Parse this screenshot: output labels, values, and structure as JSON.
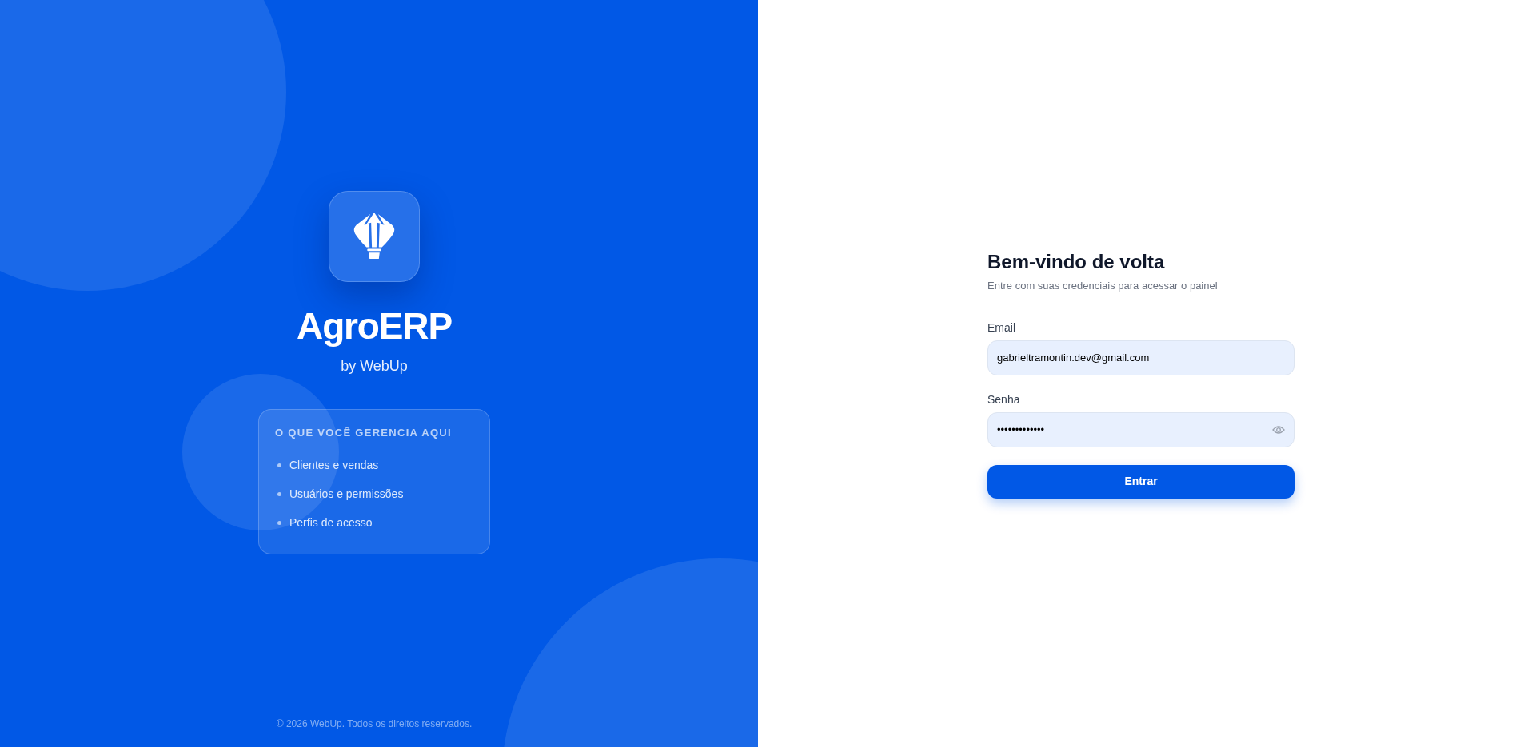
{
  "brand": {
    "name": "AgroERP",
    "tagline": "by WebUp"
  },
  "features": {
    "heading": "O QUE VOCÊ GERENCIA AQUI",
    "items": [
      "Clientes e vendas",
      "Usuários e permissões",
      "Perfis de acesso"
    ]
  },
  "footer": "© 2026 WebUp. Todos os direitos reservados.",
  "login": {
    "title": "Bem-vindo de volta",
    "subtitle": "Entre com suas credenciais para acessar o painel",
    "fields": [
      {
        "kind": "email",
        "label": "Email",
        "value": "gabrieltramontin.dev@gmail.com"
      },
      {
        "kind": "password",
        "label": "Senha",
        "value": "•••••••••••••"
      }
    ],
    "submit": "Entrar"
  }
}
